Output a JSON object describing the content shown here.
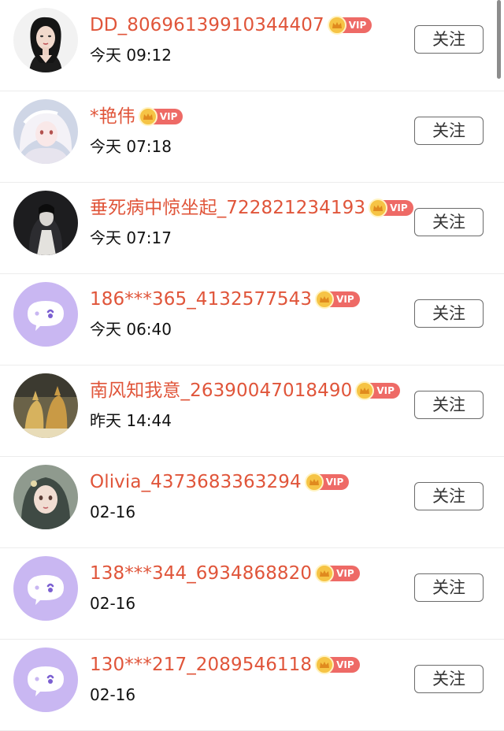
{
  "follow_label": "关注",
  "vip_label": "VIP",
  "users": [
    {
      "name": "DD_80696139910344407",
      "time": "今天 09:12",
      "avatar": "photo-woman"
    },
    {
      "name": "*艳伟",
      "time": "今天 07:18",
      "avatar": "anime-white-hair"
    },
    {
      "name": "垂死病中惊坐起_722821234193",
      "time": "今天 07:17",
      "avatar": "dark-portrait"
    },
    {
      "name": "186***365_4132577543",
      "time": "今天 06:40",
      "avatar": "default-chat"
    },
    {
      "name": "南风知我意_26390047018490",
      "time": "昨天 14:44",
      "avatar": "fox-art"
    },
    {
      "name": "Olivia_4373683363294",
      "time": "02-16",
      "avatar": "anime-girl"
    },
    {
      "name": "138***344_6934868820",
      "time": "02-16",
      "avatar": "default-chat"
    },
    {
      "name": "130***217_2089546118",
      "time": "02-16",
      "avatar": "default-chat"
    }
  ],
  "colors": {
    "name": "#e0553a",
    "vip_badge": "#ee6a66",
    "vip_crown": "#f6c445",
    "default_avatar": "#c9b7f2"
  }
}
